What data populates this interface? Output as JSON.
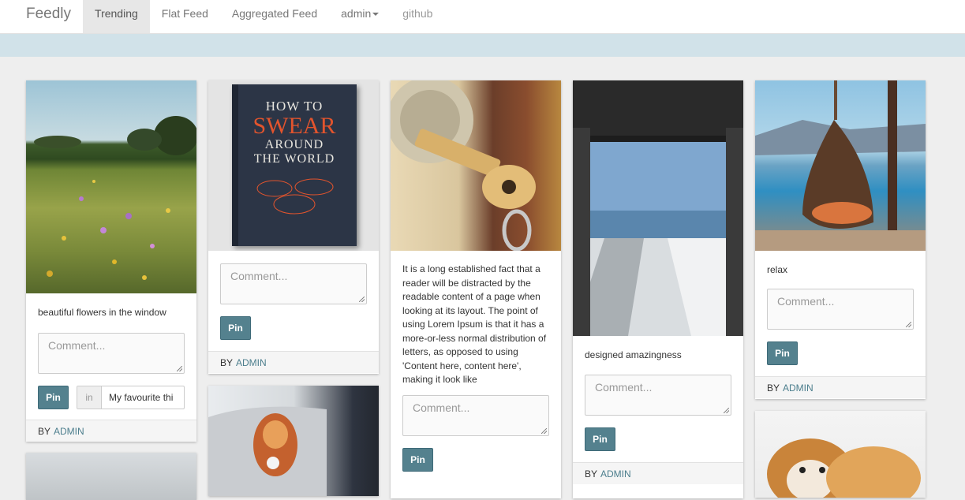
{
  "navbar": {
    "brand": "Feedly",
    "links": [
      "Trending",
      "Flat Feed",
      "Aggregated Feed",
      "admin",
      "github"
    ]
  },
  "common": {
    "comment_placeholder": "Comment...",
    "pin_label": "Pin",
    "by_label": "BY",
    "author": "ADMIN",
    "in_label": "in",
    "board_value": "My favourite thi"
  },
  "cards": [
    {
      "text": "beautiful flowers in the window"
    },
    {
      "text": ""
    },
    {
      "text": "It is a long established fact that a reader will be distracted by the readable content of a page when looking at its layout. The point of using Lorem Ipsum is that it has a more-or-less normal distribution of letters, as opposed to using 'Content here, content here', making it look like"
    },
    {
      "text": "designed amazingness"
    },
    {
      "text": "relax"
    }
  ],
  "book": {
    "line1": "HOW TO",
    "line2": "SWEAR",
    "line3": "AROUND",
    "line4": "THE WORLD"
  },
  "colors": {
    "pin": "#54818e",
    "banner": "#d1e2e9",
    "link": "#4c7e8d"
  }
}
